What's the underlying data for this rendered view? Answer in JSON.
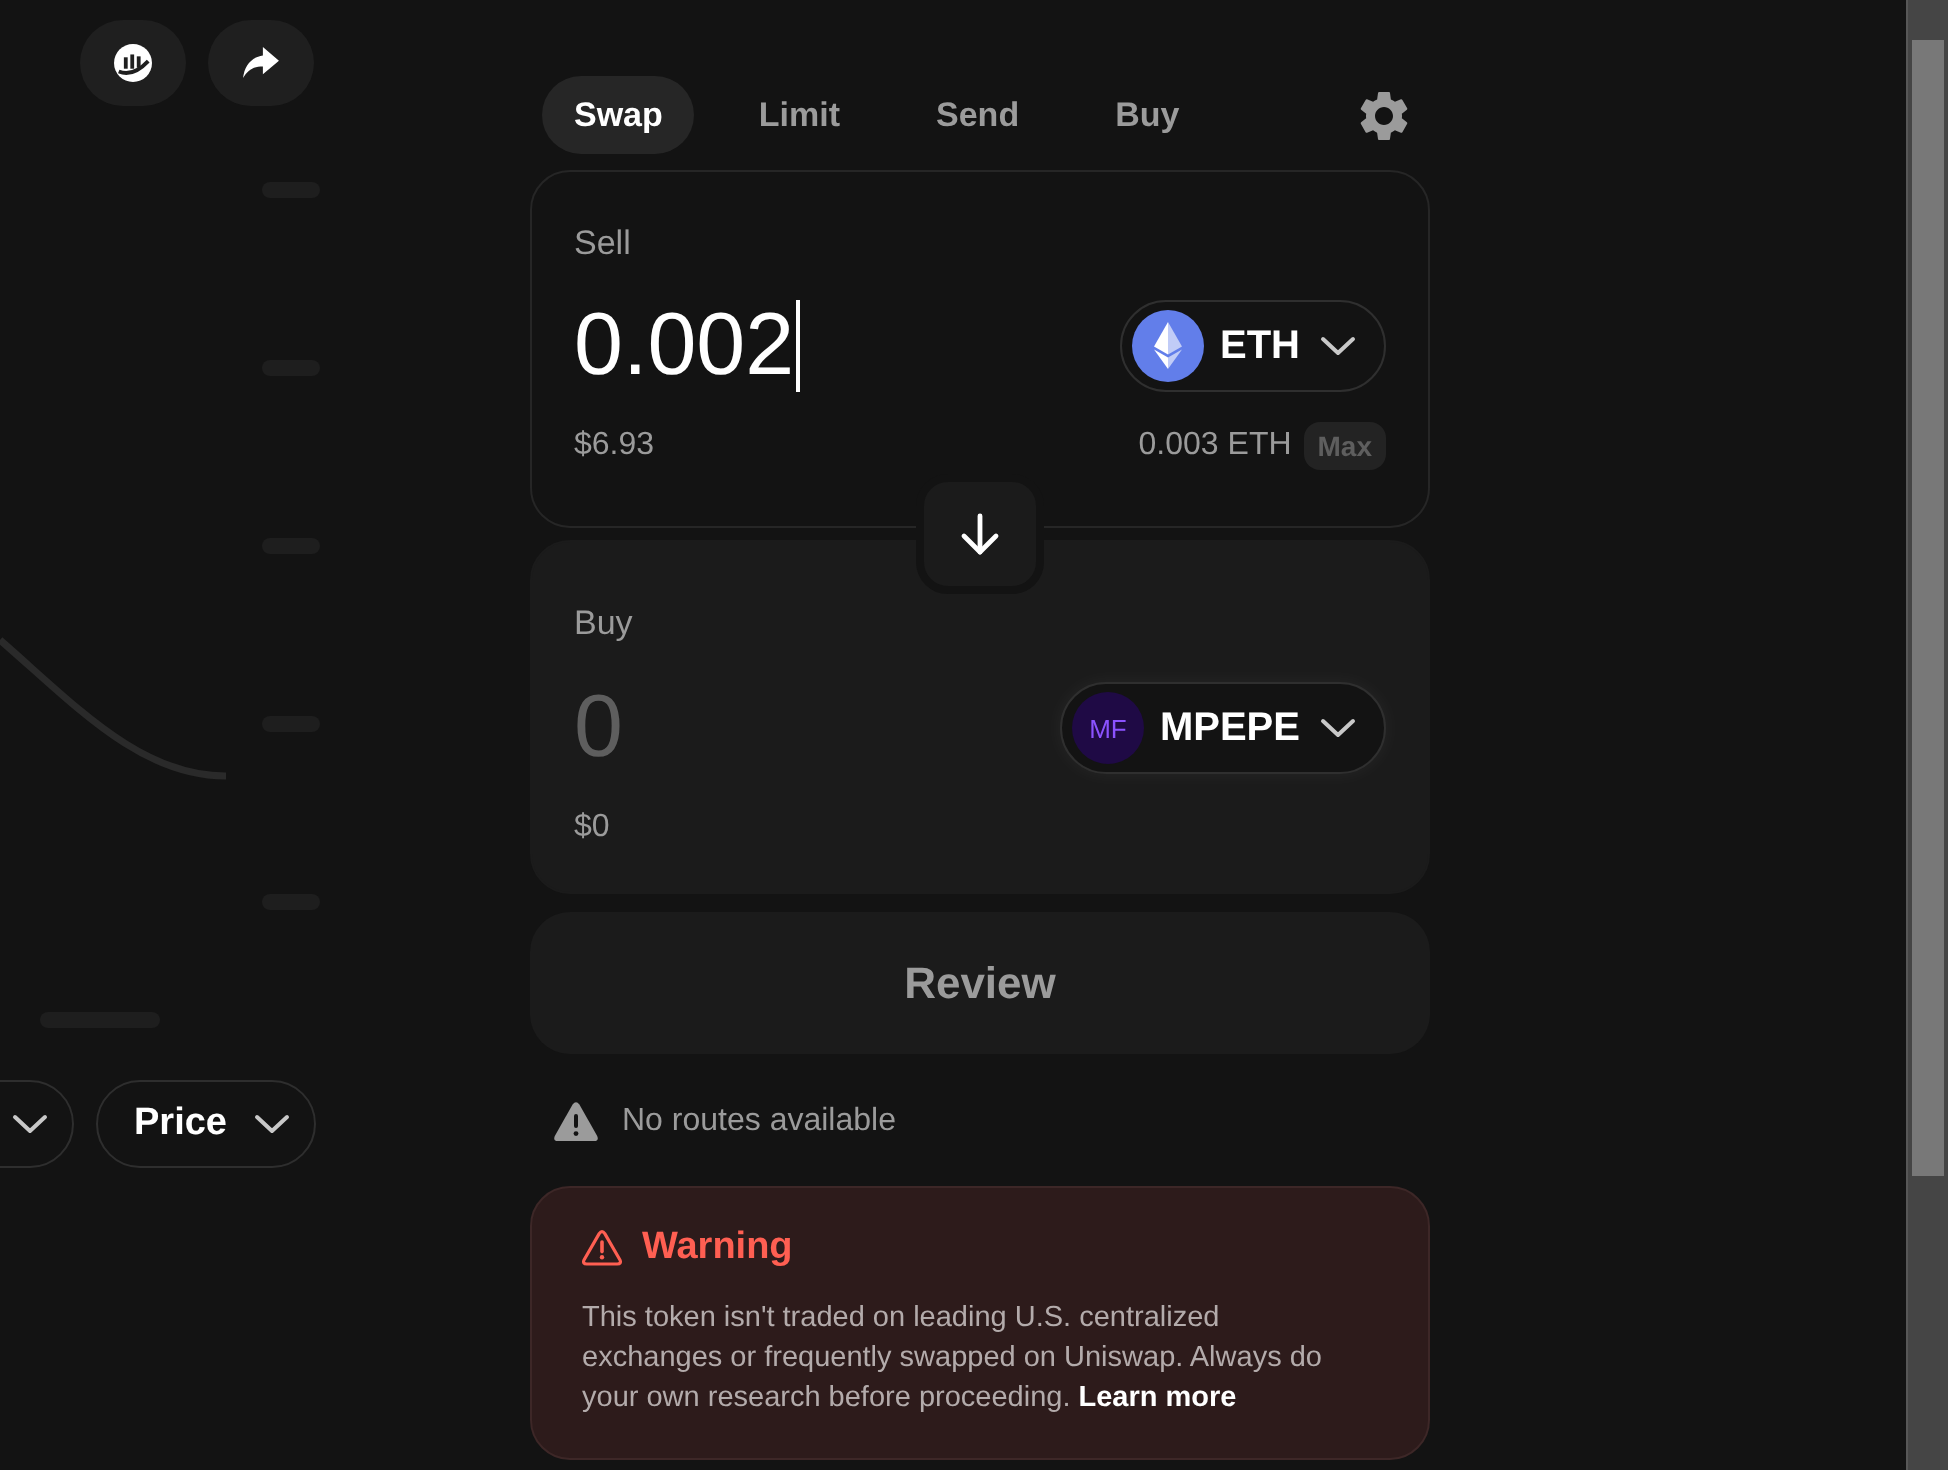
{
  "chart": {
    "selectors": [
      {
        "kind": "clipped"
      },
      {
        "kind": "labelled",
        "label": "Price"
      }
    ]
  },
  "tabs": [
    {
      "label": "Swap",
      "selected": true
    },
    {
      "label": "Limit",
      "selected": false
    },
    {
      "label": "Send",
      "selected": false
    },
    {
      "label": "Buy",
      "selected": false
    }
  ],
  "sell": {
    "label": "Sell",
    "value": "0.002",
    "focused": true,
    "token": "ETH",
    "token_logo": {
      "kind": "diamond"
    },
    "fiat": "$6.93",
    "balance": "0.003 ETH",
    "max": "Max"
  },
  "buy": {
    "label": "Buy",
    "placeholder": "0",
    "focused": false,
    "token": "MPEPE",
    "token_logo": {
      "kind": "text",
      "text": "MF"
    },
    "fiat": "$0"
  },
  "review": {
    "label": "Review",
    "disabled": true
  },
  "notice": {
    "text": "No routes available"
  },
  "warning": {
    "title": "Warning",
    "body": "This token isn't traded on leading U.S. centralized exchanges or frequently swapped on Uniswap. Always do your own research before proceeding.",
    "link": "Learn more"
  }
}
